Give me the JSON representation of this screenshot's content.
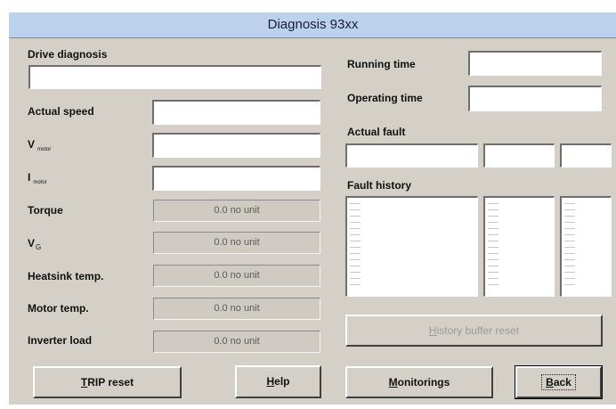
{
  "window": {
    "title": "Diagnosis 93xx"
  },
  "left": {
    "drive_diagnosis_label": "Drive diagnosis",
    "actual_speed_label": "Actual speed",
    "v_motor_main": "V",
    "v_motor_sub": "motor",
    "i_motor_main": "I",
    "i_motor_sub": "motor",
    "torque_label": "Torque",
    "torque_value": "0.0 no unit",
    "vg_main": "V",
    "vg_sub": "G",
    "vg_value": "0.0 no unit",
    "heatsink_label": "Heatsink temp.",
    "heatsink_value": "0.0 no unit",
    "motor_temp_label": "Motor temp.",
    "motor_temp_value": "0.0 no unit",
    "inverter_label": "Inverter load",
    "inverter_value": "0.0 no unit"
  },
  "right": {
    "running_time_label": "Running time",
    "operating_time_label": "Operating time",
    "actual_fault_label": "Actual fault",
    "fault_history_label": "Fault history"
  },
  "buttons": {
    "history_reset": {
      "mnemonic": "H",
      "rest": "istory buffer reset"
    },
    "trip_reset": {
      "mnemonic": "T",
      "rest": "RIP reset"
    },
    "help": {
      "mnemonic": "H",
      "rest": "elp"
    },
    "monitorings": {
      "mnemonic": "M",
      "rest": "onitorings"
    },
    "back": {
      "mnemonic": "B",
      "rest": "ack"
    }
  }
}
